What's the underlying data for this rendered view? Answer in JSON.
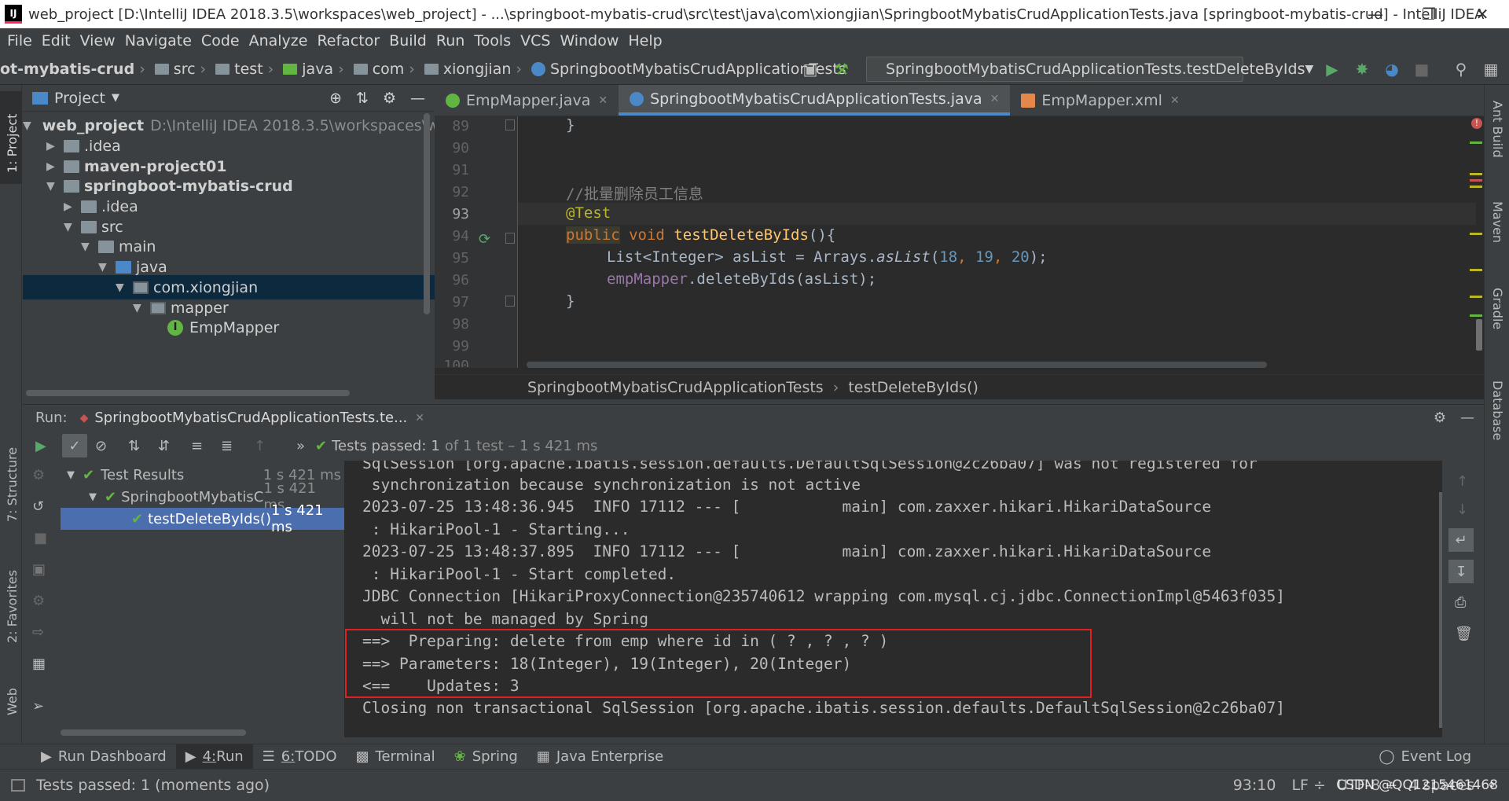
{
  "window": {
    "title": "web_project [D:\\IntelliJ IDEA 2018.3.5\\workspaces\\web_project] - ...\\springboot-mybatis-crud\\src\\test\\java\\com\\xiongjian\\SpringbootMybatisCrudApplicationTests.java [springboot-mybatis-crud] - IntelliJ IDEA",
    "app_icon_text": "IJ"
  },
  "menu": [
    "File",
    "Edit",
    "View",
    "Navigate",
    "Code",
    "Analyze",
    "Refactor",
    "Build",
    "Run",
    "Tools",
    "VCS",
    "Window",
    "Help"
  ],
  "breadcrumb": [
    "ot-mybatis-crud",
    "src",
    "test",
    "java",
    "com",
    "xiongjian",
    "SpringbootMybatisCrudApplicationTests"
  ],
  "run_config": "SpringbootMybatisCrudApplicationTests.testDeleteByIds",
  "left_stripe": [
    "1: Project",
    "7: Structure",
    "2: Favorites",
    "Web"
  ],
  "right_stripe": [
    "Ant Build",
    "Maven",
    "Gradle",
    "Database"
  ],
  "project": {
    "header": "Project",
    "tree": [
      {
        "label": "web_project",
        "extra": "D:\\IntelliJ IDEA 2018.3.5\\workspaces\\we",
        "bold": true
      },
      {
        "label": ".idea"
      },
      {
        "label": "maven-project01",
        "bold": true
      },
      {
        "label": "springboot-mybatis-crud",
        "bold": true
      },
      {
        "label": ".idea"
      },
      {
        "label": "src"
      },
      {
        "label": "main"
      },
      {
        "label": "java"
      },
      {
        "label": "com.xiongjian"
      },
      {
        "label": "mapper"
      },
      {
        "label": "EmpMapper"
      }
    ]
  },
  "editor": {
    "tabs": [
      "EmpMapper.java",
      "SpringbootMybatisCrudApplicationTests.java",
      "EmpMapper.xml"
    ],
    "line_numbers": [
      "89",
      "90",
      "91",
      "92",
      "93",
      "94",
      "95",
      "96",
      "97",
      "98",
      "99",
      "100"
    ],
    "code": {
      "l89": "}",
      "l92": "//批量删除员工信息",
      "l93": "@Test",
      "l94_kw": "public",
      "l94_type": "void",
      "l94_name": "testDeleteByIds",
      "l94_rest": "(){",
      "l95_a": "List<Integer> asList = Arrays.",
      "l95_m": "asList",
      "l95_p1": "(",
      "l95_n1": "18",
      "l95_c1": ", ",
      "l95_n2": "19",
      "l95_c2": ", ",
      "l95_n3": "20",
      "l95_end": ");",
      "l96_f": "empMapper",
      "l96_rest": ".deleteByIds(asList);",
      "l97": "}"
    },
    "crumb": [
      "SpringbootMybatisCrudApplicationTests",
      "testDeleteByIds()"
    ]
  },
  "run": {
    "label": "Run:",
    "tab": "SpringbootMybatisCrudApplicationTests.te...",
    "status_prefix": "Tests passed:",
    "status_count": "1",
    "status_suffix": "of 1 test – 1 s 421 ms",
    "test_tree": [
      {
        "label": "Test Results",
        "time": "1 s 421 ms"
      },
      {
        "label": "SpringbootMybatisC",
        "time": "1 s 421 ms"
      },
      {
        "label": "testDeleteByIds()",
        "time": "1 s 421 ms"
      }
    ],
    "console": [
      "SqlSession [org.apache.ibatis.session.defaults.DefaultSqlSession@2c26ba07] was not registered for",
      " synchronization because synchronization is not active",
      "2023-07-25 13:48:36.945  INFO 17112 --- [           main] com.zaxxer.hikari.HikariDataSource",
      " : HikariPool-1 - Starting...",
      "2023-07-25 13:48:37.895  INFO 17112 --- [           main] com.zaxxer.hikari.HikariDataSource",
      " : HikariPool-1 - Start completed.",
      "JDBC Connection [HikariProxyConnection@235740612 wrapping com.mysql.cj.jdbc.ConnectionImpl@5463f035]",
      "  will not be managed by Spring",
      "==>  Preparing: delete from emp where id in ( ? , ? , ? )",
      "==> Parameters: 18(Integer), 19(Integer), 20(Integer)",
      "<==    Updates: 3",
      "Closing non transactional SqlSession [org.apache.ibatis.session.defaults.DefaultSqlSession@2c26ba07]"
    ]
  },
  "bottom_tabs": [
    {
      "label": "Run Dashboard",
      "mnemonic": ""
    },
    {
      "label": "Run",
      "mnemonic": "4: "
    },
    {
      "label": "TODO",
      "mnemonic": "6: "
    },
    {
      "label": "Terminal",
      "mnemonic": ""
    },
    {
      "label": "Spring",
      "mnemonic": ""
    },
    {
      "label": "Java Enterprise",
      "mnemonic": ""
    }
  ],
  "event_log": "Event Log",
  "status": {
    "message": "Tests passed: 1 (moments ago)",
    "position": "93:10",
    "line_sep": "LF ÷",
    "encoding": "UTF-8 ÷",
    "indent": "4 spaces",
    "watermark": "CSDN @QQ1215461468"
  },
  "colors": {
    "accent": "#4a88c7",
    "pass": "#62b543",
    "run": "#59a869",
    "highlight_box": "#e02020"
  }
}
